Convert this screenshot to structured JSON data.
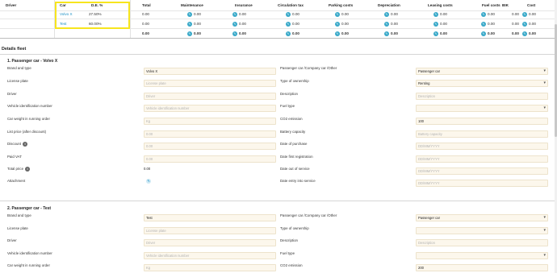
{
  "summary": {
    "headers": {
      "driver": "Driver",
      "car": "Car",
      "de": "D.E. %",
      "total": "Total",
      "maintenance": "Maintenance",
      "insurance": "Insurance",
      "circulation_tax": "Circulation tax",
      "parking": "Parking costs",
      "depreciation": "Depreciation",
      "leasing": "Leasing costs",
      "fuel": "Fuel costs",
      "bik": "BIK",
      "cost": "Cost"
    },
    "rows": [
      {
        "car": "Volvo X",
        "de": "27.50%",
        "total": "0.00",
        "maintenance": "0.00",
        "insurance": "0.00",
        "circulation_tax": "0.00",
        "parking": "0.00",
        "depreciation": "0.00",
        "leasing": "0.00",
        "fuel": "0.00",
        "bik": "0.00",
        "cost": "0.00"
      },
      {
        "car": "Test",
        "de": "60.00%",
        "total": "0.00",
        "maintenance": "0.00",
        "insurance": "0.00",
        "circulation_tax": "0.00",
        "parking": "0.00",
        "depreciation": "0.00",
        "leasing": "0.00",
        "fuel": "0.00",
        "bik": "0.00",
        "cost": "0.00"
      }
    ],
    "totals": {
      "total": "0.00",
      "maintenance": "0.00",
      "insurance": "0.00",
      "circulation_tax": "0.00",
      "parking": "0.00",
      "depreciation": "0.00",
      "leasing": "0.00",
      "fuel": "0.00",
      "bik": "0.00",
      "cost": "0.00"
    },
    "edit_icon_glyph": "✎",
    "highlight_color": "#f7e51d"
  },
  "details": {
    "title": "Details fleet",
    "cars": [
      {
        "heading": "1.   Passenger car - Volvo X",
        "left": {
          "brand_label": "Brand and type",
          "brand_value": "Volvo X",
          "plate_label": "License plate",
          "plate_ph": "License plate",
          "driver_label": "Driver",
          "driver_ph": "Driver",
          "vin_label": "Vehicle identification number",
          "vin_ph": "Vehicle identification number",
          "weight_label": "Car weight in running order",
          "weight_ph": "Kg",
          "list_price_label": "List price (after discount)",
          "list_price_ph": "0.00",
          "discount_label": "Discount",
          "discount_ph": "0.00",
          "paid_vat_label": "Paid VAT",
          "paid_vat_ph": "0.00",
          "total_price_label": "Total price",
          "total_price_value": "0.00",
          "attachment_label": "Attachment"
        },
        "right": {
          "category_label": "Passenger car /Company car /Other",
          "category_value": "Passenger car",
          "ownership_label": "Type of ownership",
          "ownership_value": "Renting",
          "description_label": "Description",
          "description_ph": "Description",
          "fuel_label": "Fuel type",
          "co2_label": "CO2 emission",
          "co2_value": "100",
          "battery_label": "Battery capacity",
          "battery_ph": "Battery capacity",
          "purchase_label": "Date of purchase",
          "purchase_ph": "DD/MM/YYYY",
          "first_reg_label": "Date first registration",
          "first_reg_ph": "DD/MM/YYYY",
          "out_label": "Date out of service",
          "out_ph": "DD/MM/YYYY",
          "entry_label": "Date entry into service",
          "entry_ph": "DD/MM/YYYY"
        }
      },
      {
        "heading": "2.   Passenger car - Test",
        "left": {
          "brand_label": "Brand and type",
          "brand_value": "Test",
          "plate_label": "License plate",
          "plate_ph": "License plate",
          "driver_label": "Driver",
          "driver_ph": "Driver",
          "vin_label": "Vehicle identification number",
          "vin_ph": "Vehicle identification number",
          "weight_label": "Car weight in running order",
          "weight_ph": "Kg"
        },
        "right": {
          "category_label": "Passenger car /Company car /Other",
          "category_value": "Passenger car",
          "ownership_label": "Type of ownership",
          "description_label": "Description",
          "description_ph": "Description",
          "fuel_label": "Fuel type",
          "co2_label": "CO2 emission",
          "co2_value": "200"
        }
      }
    ],
    "info_glyph": "i",
    "attach_glyph": "✎"
  }
}
